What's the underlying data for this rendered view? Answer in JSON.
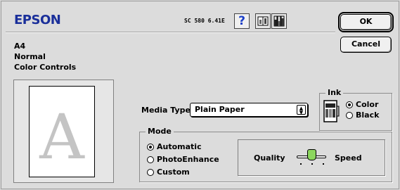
{
  "header": {
    "brand": "EPSON",
    "version": "SC 580 6.41E",
    "help_glyph": "?"
  },
  "buttons": {
    "ok_label": "OK",
    "cancel_label": "Cancel"
  },
  "summary": {
    "paper_size": "A4",
    "quality": "Normal",
    "color_mode": "Color Controls"
  },
  "preview": {
    "letter": "A"
  },
  "media": {
    "label": "Media Type:",
    "selected": "Plain Paper"
  },
  "ink": {
    "title": "Ink",
    "options": [
      "Color",
      "Black"
    ],
    "selected": "Color"
  },
  "mode": {
    "title": "Mode",
    "options": [
      "Automatic",
      "PhotoEnhance",
      "Custom"
    ],
    "selected": "Automatic"
  },
  "quality_speed": {
    "quality_label": "Quality",
    "speed_label": "Speed",
    "level": 0.5
  },
  "colors": {
    "brand": "#1a2f9a",
    "help": "#1a3fc8",
    "slider_thumb": "#8cd65e"
  },
  "icons": [
    "help-icon",
    "utility-icon",
    "ink-levels-icon",
    "ink-cartridge-icon"
  ]
}
